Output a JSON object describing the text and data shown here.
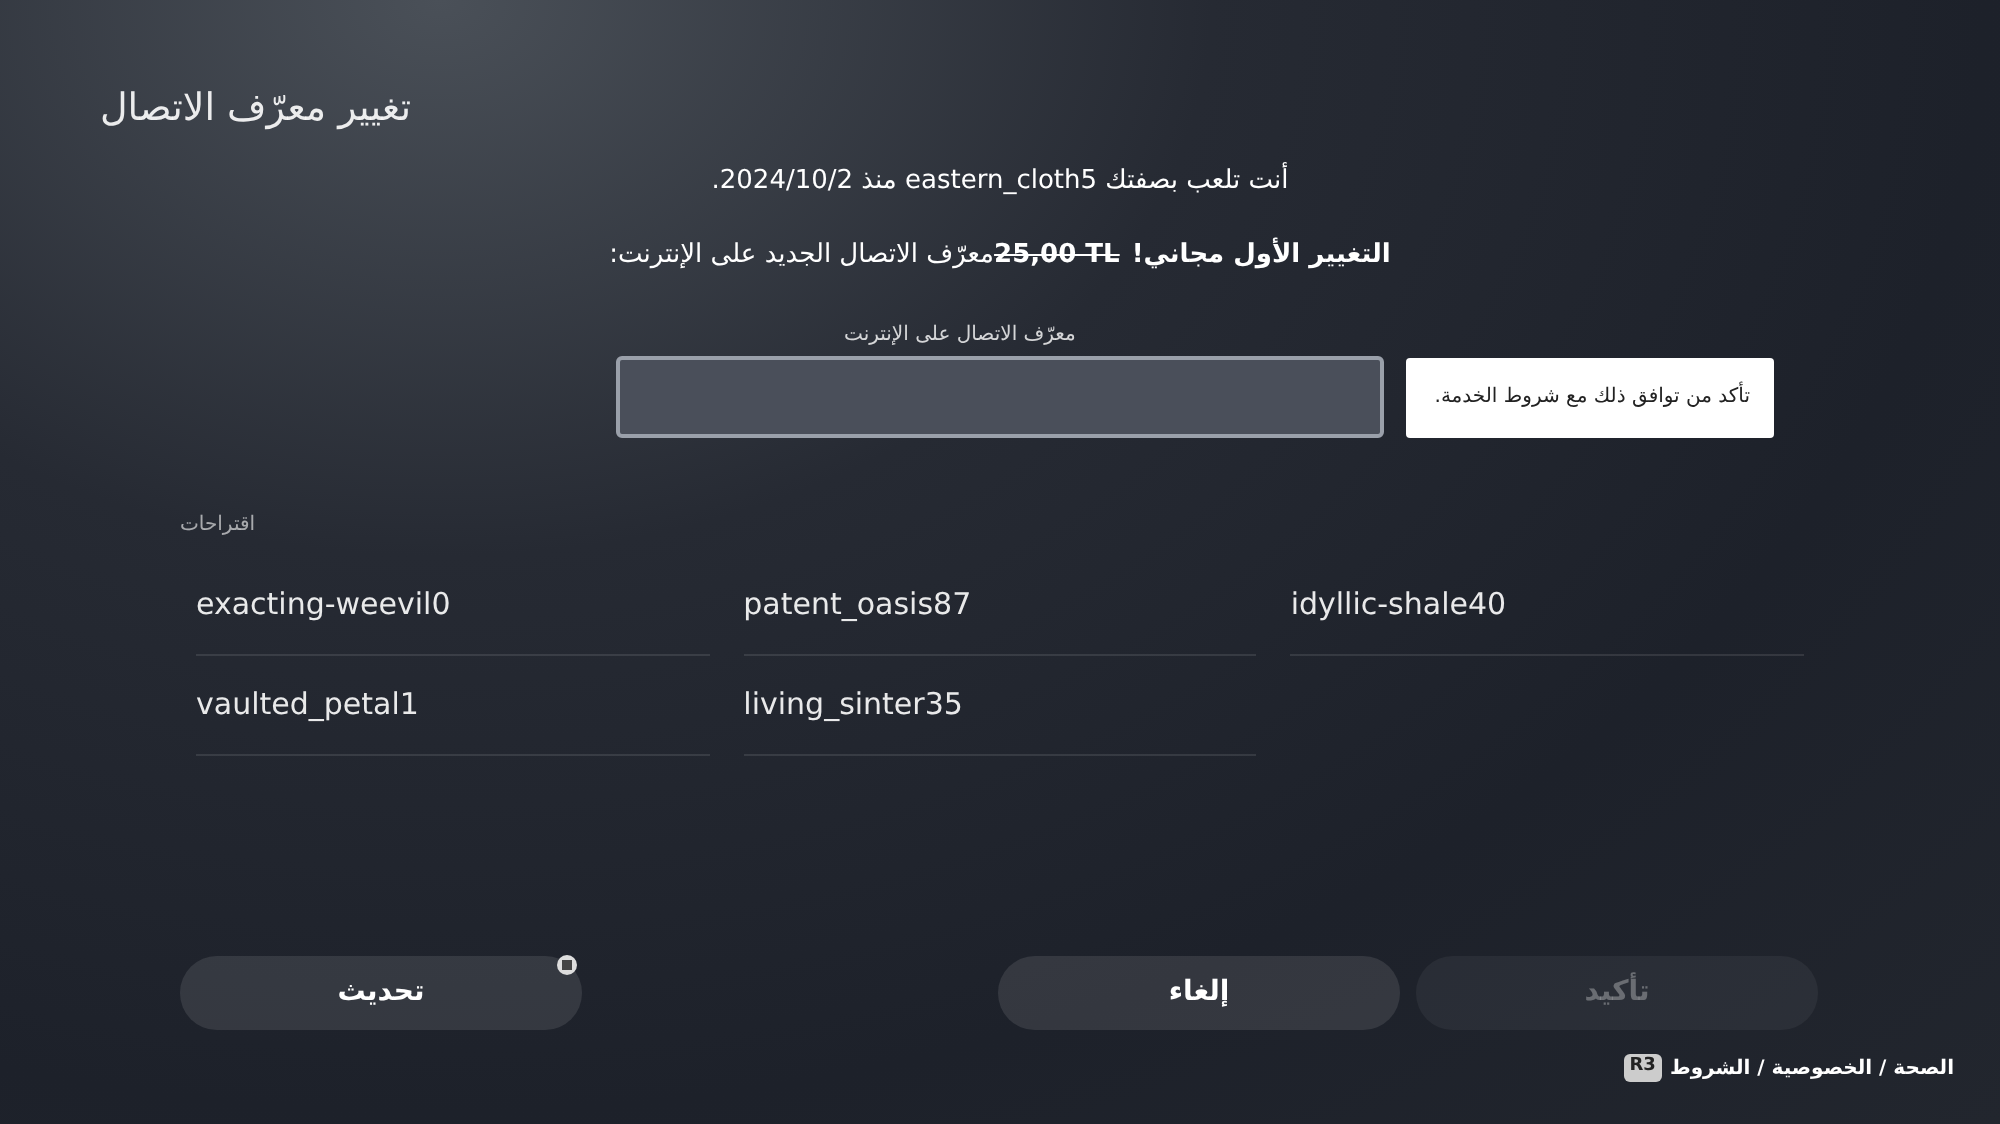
{
  "title": "تغيير معرّف الاتصال",
  "playing_as": "أنت تلعب بصفتك eastern_cloth5 منذ 2024/10/2.",
  "offer": {
    "free_note": "التغيير الأول مجاني!",
    "old_price": "25,00 TL",
    "text": "معرّف الاتصال الجديد على الإنترنت:"
  },
  "online_id_field": {
    "label": "معرّف الاتصال على الإنترنت"
  },
  "tooltip": "تأكد من توافق ذلك مع شروط الخدمة.",
  "suggestions": {
    "label": "اقتراحات",
    "items": [
      "idyllic-shale40",
      "patent_oasis87",
      "exacting-weevil0",
      "living_sinter35",
      "vaulted_petal1"
    ]
  },
  "buttons": [
    {
      "label": "تأكيد",
      "kind": "confirm",
      "disabled": true
    },
    {
      "label": "إلغاء",
      "kind": "cancel",
      "disabled": false
    },
    {
      "label": "تحديث",
      "kind": "refresh",
      "disabled": false
    }
  ],
  "footer": {
    "key": "R3",
    "links": "الصحة / الخصوصية / الشروط"
  }
}
